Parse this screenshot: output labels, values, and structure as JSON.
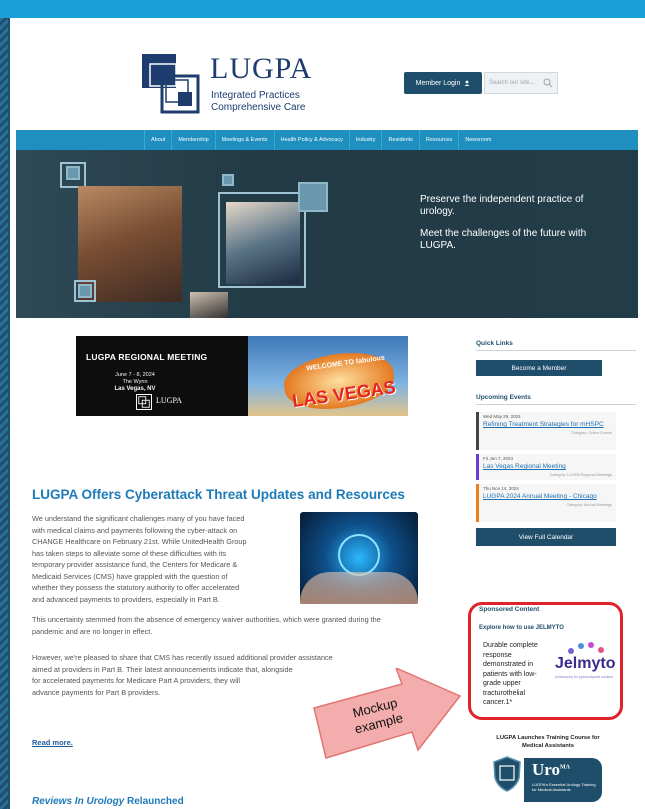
{
  "header": {
    "logo_name": "LUGPA",
    "logo_tagline_1": "Integrated Practices",
    "logo_tagline_2": "Comprehensive Care",
    "login_label": "Member Login",
    "search_placeholder": "Search our site..."
  },
  "nav": {
    "items": [
      "About",
      "Membership",
      "Meetings & Events",
      "Health Policy & Advocacy",
      "Industry",
      "Residents",
      "Resources",
      "Newsroom"
    ]
  },
  "hero": {
    "line1": "Preserve the independent practice of urology.",
    "line2": "Meet the challenges of the future with LUGPA."
  },
  "banner": {
    "title": "LUGPA REGIONAL MEETING",
    "dates": "June 7 - 8, 2024",
    "venue": "The Wynn",
    "city": "Las Vegas, NV",
    "logo_text": "LUGPA",
    "sign_welcome": "WELCOME TO fabulous",
    "sign_city": "LAS VEGAS"
  },
  "article": {
    "title": "LUGPA Offers Cyberattack Threat Updates and Resources",
    "p1_lines": [
      "We understand the significant challenges many of you have faced",
      "with medical claims and payments following the cyber-attack on",
      "CHANGE Healthcare on February 21st. While UnitedHealth Group",
      "has taken steps to alleviate some of these difficulties with its",
      "temporary provider assistance fund, the Centers for Medicare &",
      "Medicaid Services (CMS) have grappled with the question of",
      "whether they possess the statutory authority to offer accelerated",
      "and advanced payments to providers, especially in Part B."
    ],
    "p2_lines": [
      "This uncertainty stemmed from the absence of emergency waiver authorities, which were granted during the",
      "pandemic and are no longer in effect."
    ],
    "p3_lines": [
      "However, we're pleased to share that CMS has recently issued additional provider assistance",
      "aimed at providers in Part B. Their latest announcements indicate that, alongside",
      "for accelerated payments for Medicare Part A providers, they will",
      "advance payments for Part B providers."
    ],
    "read_more": "Read more."
  },
  "next_article": {
    "title_italic": "Reviews In Urology",
    "title_rest": " Relaunched"
  },
  "callout": {
    "text_1": "Mockup",
    "text_2": "example"
  },
  "sidebar": {
    "quick_links_title": "Quick Links",
    "become_member": "Become a Member",
    "upcoming_title": "Upcoming Events",
    "events": [
      {
        "date": "Wed May 29, 2024",
        "title": "Refining Treatment Strategies for mHSPC",
        "category": "Category: Online Events",
        "color": "#444444"
      },
      {
        "date": "Fri Jun 7, 2024",
        "title": "Las Vegas Regional Meeting",
        "category": "Category: LUGPA Regional Meetings",
        "color": "#6a3fd6"
      },
      {
        "date": "Thu Nov 14, 2024",
        "title": "LUGPA 2024 Annual Meeting - Chicago",
        "category": "Category: Annual Meetings",
        "color": "#e8811e"
      }
    ],
    "full_calendar": "View Full Calendar",
    "sponsored_title": "Sponsored Content",
    "sponsor_sub": "Explore how to use JELMYTO",
    "sponsor_body": "Durable complete response demonstrated in patients with low-grade upper tracturothelial cancer.1*",
    "sponsor_brand": "Jelmyto",
    "sponsor_brand_sub": "(mitomycin) for pyelocalyceal solution",
    "training_caption_1": "LUGPA Launches Training Course for",
    "training_caption_2": "Medical Assistants",
    "uroma_name": "Uro",
    "uroma_sup": "MA",
    "uroma_sub": "LUGPA's Essential Urology Training for Medical Assistants"
  }
}
